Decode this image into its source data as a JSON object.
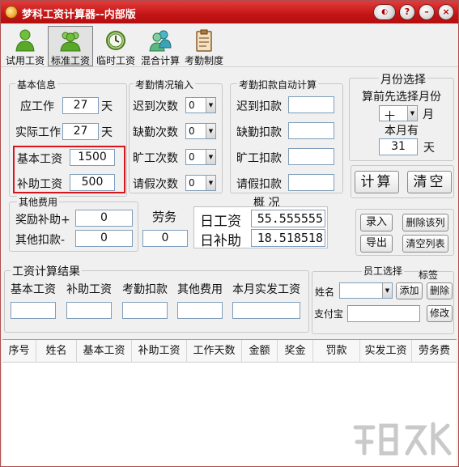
{
  "window": {
    "title": "梦科工资计算器--内部版"
  },
  "toolbar": [
    {
      "label": "试用工资",
      "icon": "person-green-icon"
    },
    {
      "label": "标准工资",
      "icon": "people-group-icon",
      "active": true
    },
    {
      "label": "临时工资",
      "icon": "clock-icon"
    },
    {
      "label": "混合计算",
      "icon": "people-teal-icon"
    },
    {
      "label": "考勤制度",
      "icon": "clipboard-icon"
    }
  ],
  "basic_info": {
    "title": "基本信息",
    "should_work_label": "应工作",
    "should_work_value": "27",
    "actual_work_label": "实际工作",
    "actual_work_value": "27",
    "day_unit": "天",
    "base_salary_label": "基本工资",
    "base_salary_value": "1500",
    "subsidy_label": "补助工资",
    "subsidy_value": "500"
  },
  "attendance_input": {
    "title": "考勤情况输入",
    "rows": [
      {
        "label": "迟到次数",
        "value": "0"
      },
      {
        "label": "缺勤次数",
        "value": "0"
      },
      {
        "label": "旷工次数",
        "value": "0"
      },
      {
        "label": "请假次数",
        "value": "0"
      }
    ]
  },
  "deduction_auto": {
    "title": "考勤扣款自动计算",
    "rows": [
      {
        "label": "迟到扣款",
        "value": ""
      },
      {
        "label": "缺勤扣款",
        "value": ""
      },
      {
        "label": "旷工扣款",
        "value": ""
      },
      {
        "label": "请假扣款",
        "value": ""
      }
    ]
  },
  "month_select": {
    "title": "月份选择",
    "hint": "算前先选择月份",
    "month_value": "十",
    "month_unit": "月",
    "days_label": "本月有",
    "days_value": "31",
    "days_unit": "天"
  },
  "actions": {
    "calculate": "计算",
    "clear": "清空"
  },
  "other_fees": {
    "title": "其他费用",
    "bonus_label": "奖励补助+",
    "bonus_value": "0",
    "deduct_label": "其他扣款-",
    "deduct_value": "0"
  },
  "labor": {
    "label": "劳务",
    "value": "0"
  },
  "summary": {
    "title": "概  况",
    "daily_wage_label": "日工资",
    "daily_wage_value": "55.555555",
    "daily_subsidy_label": "日补助",
    "daily_subsidy_value": "18.518518"
  },
  "record_buttons": {
    "enter": "录入",
    "delete_row": "删除该列",
    "export": "导出",
    "clear_list": "清空列表"
  },
  "result": {
    "title": "工资计算结果",
    "fields": [
      {
        "label": "基本工资",
        "value": ""
      },
      {
        "label": "补助工资",
        "value": ""
      },
      {
        "label": "考勤扣款",
        "value": ""
      },
      {
        "label": "其他费用",
        "value": ""
      },
      {
        "label": "本月实发工资",
        "value": ""
      }
    ]
  },
  "employee": {
    "title": "员工选择",
    "tag_label": "标签",
    "name_label": "姓名",
    "name_value": "",
    "add": "添加",
    "delete": "删除",
    "alipay_label": "支付宝",
    "alipay_value": "",
    "modify": "修改"
  },
  "table": {
    "columns": [
      "序号",
      "姓名",
      "基本工资",
      "补助工资",
      "工作天数",
      "金额",
      "奖金",
      "罚款",
      "实发工资",
      "劳务费"
    ]
  }
}
